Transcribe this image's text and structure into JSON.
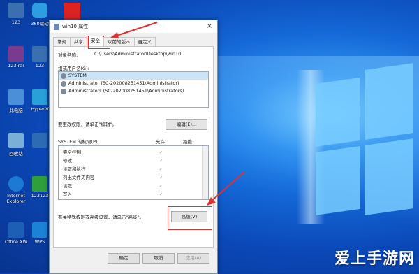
{
  "desktop": {
    "icons": [
      {
        "label": "123",
        "color": "#3a6fb0"
      },
      {
        "label": "360驱动",
        "color": "#2d9ee0"
      },
      {
        "label": "",
        "color": "#d22"
      },
      {
        "label": "123.rar",
        "color": "#7a3b8e"
      },
      {
        "label": "123",
        "color": "#3a6fb0"
      },
      {
        "label": "此电脑",
        "color": "#4a8fd8"
      },
      {
        "label": "Hyper-V",
        "color": "#2aa0d8"
      },
      {
        "label": "回收站",
        "color": "#7ab0d8"
      },
      {
        "label": "",
        "color": "#2d6bb5"
      },
      {
        "label": "Internet Explorer",
        "color": "#1c79d4"
      },
      {
        "label": "123123",
        "color": "#2f9f3a"
      },
      {
        "label": "Office XW",
        "color": "#1d5fb5"
      },
      {
        "label": "WPS",
        "color": "#1b82d6"
      }
    ],
    "watermark": "爱上手游网"
  },
  "dialog": {
    "title": "win10 属性",
    "close": "×",
    "tabs": [
      "常规",
      "共享",
      "安全",
      "以前的版本",
      "自定义"
    ],
    "active_tab": "安全",
    "object_label": "对象名称:",
    "object_value": "C:\\Users\\Administrator\\Desktop\\win10",
    "group_label": "组或用户名(G):",
    "users": [
      "SYSTEM",
      "Administrator (SC-202008251451\\Administrator)",
      "Administrators (SC-202008251451\\Administrators)"
    ],
    "selected_user": "SYSTEM",
    "change_hint": "要更改权限，请单击\"编辑\"。",
    "edit_button": "编辑(E)...",
    "perm_header": "SYSTEM 的权限(P)",
    "allow_header": "允许",
    "deny_header": "拒绝",
    "permissions": [
      {
        "name": "完全控制",
        "allow": "✓"
      },
      {
        "name": "修改",
        "allow": "✓"
      },
      {
        "name": "读取和执行",
        "allow": "✓"
      },
      {
        "name": "列出文件夹内容",
        "allow": "✓"
      },
      {
        "name": "读取",
        "allow": "✓"
      },
      {
        "name": "写入",
        "allow": "✓"
      }
    ],
    "advanced_hint": "有关特殊权限或高级设置，请单击\"高级\"。",
    "advanced_button": "高级(V)",
    "ok_button": "确定",
    "cancel_button": "取消",
    "apply_button": "应用(A)"
  },
  "colors": {
    "highlight_red": "#e03030",
    "selection_blue": "#cce4f7"
  }
}
